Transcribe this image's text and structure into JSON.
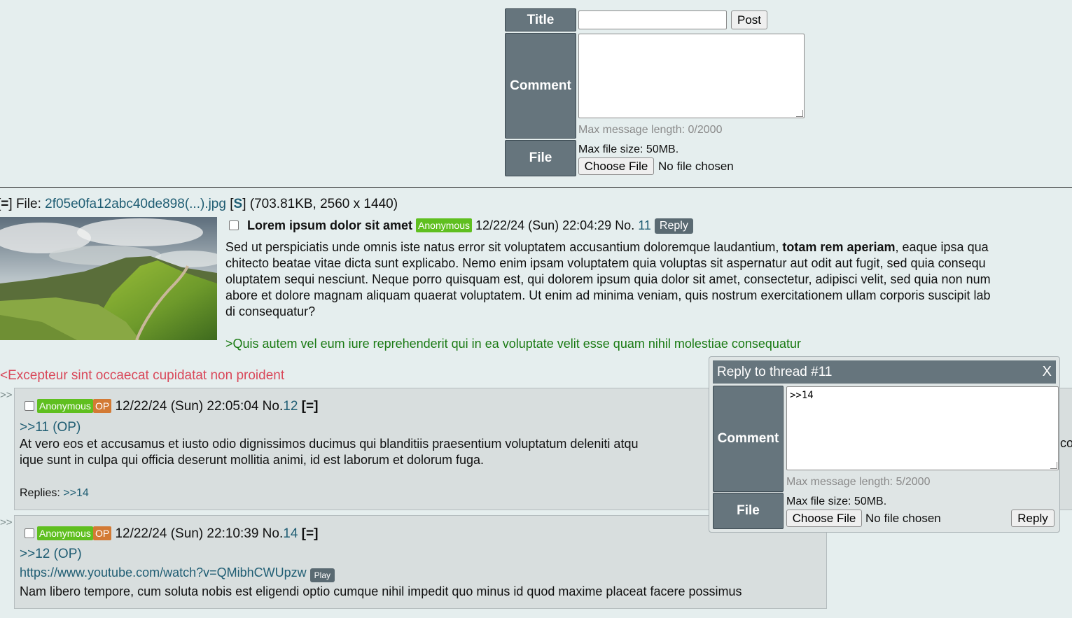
{
  "post_form": {
    "title_label": "Title",
    "title_value": "",
    "post_button": "Post",
    "comment_label": "Comment",
    "comment_value": "",
    "max_message": "Max message length: 0/2000",
    "file_label": "File",
    "max_file": "Max file size: 50MB.",
    "choose_file": "Choose File",
    "no_file": "No file chosen"
  },
  "op": {
    "file_prefix_open": "[",
    "file_prefix_eq": "=",
    "file_prefix_close": "] File:",
    "file_name": "2f05e0fa12abc40de898(...).jpg",
    "s_open": "[",
    "s_link": "S",
    "s_close": "]",
    "file_meta": "(703.81KB, 2560 x 1440)",
    "subject": "Lorem ipsum dolor sit amet",
    "name": "Anonymous",
    "datetime": "12/22/24 (Sun) 22:04:29",
    "no_label": "No.",
    "no": "11",
    "reply_button": "Reply",
    "body_lines": [
      {
        "pre": "Sed ut perspiciatis unde omnis iste natus error sit voluptatem accusantium doloremque laudantium, ",
        "bold": "totam rem aperiam",
        "post": ", eaque ipsa qua"
      },
      {
        "pre": "chitecto beatae vitae dicta sunt explicabo. Nemo enim ipsam voluptatem quia voluptas sit aspernatur aut odit aut fugit, sed quia consequ",
        "bold": "",
        "post": ""
      },
      {
        "pre": "oluptatem sequi nesciunt. Neque porro quisquam est, qui dolorem ipsum quia dolor sit amet, consectetur, adipisci velit, sed quia non num",
        "bold": "",
        "post": ""
      },
      {
        "pre": "abore et dolore magnam aliquam quaerat voluptatem. Ut enim ad minima veniam, quis nostrum exercitationem ullam corporis suscipit lab",
        "bold": "",
        "post": ""
      },
      {
        "pre": "di consequatur?",
        "bold": "",
        "post": ""
      }
    ],
    "greentext": ">Quis autem vel eum iure reprehenderit qui in ea voluptate velit esse quam nihil molestiae consequatur",
    "redtext": "<Excepteur sint occaecat cupidatat non proident"
  },
  "replies": [
    {
      "arrow": ">>",
      "name": "Anonymous",
      "op_badge": "OP",
      "datetime": "12/22/24 (Sun) 22:05:04",
      "no_label": "No.",
      "no": "12",
      "menu": "[=]",
      "quote": ">>11 (OP)",
      "body_lines": [
        "At vero eos et accusamus et iusto odio dignissimos ducimus qui blanditiis praesentium voluptatum deleniti atqu",
        "ique sunt in culpa qui officia deserunt mollitia animi, id est laborum et dolorum fuga."
      ],
      "body_tail": "co",
      "replies_label": "Replies:",
      "replies_link": ">>14"
    },
    {
      "arrow": ">>",
      "name": "Anonymous",
      "op_badge": "OP",
      "datetime": "12/22/24 (Sun) 22:10:39",
      "no_label": "No.",
      "no": "14",
      "menu": "[=]",
      "quote": ">>12 (OP)",
      "link": "https://www.youtube.com/watch?v=QMibhCWUpzw",
      "play": "Play",
      "body": "Nam libero tempore, cum soluta nobis est eligendi optio cumque nihil impedit quo minus id quod maxime placeat facere possimus"
    }
  ],
  "quick_reply": {
    "title": "Reply to thread #11",
    "close": "X",
    "comment_label": "Comment",
    "comment_value": ">>14",
    "max_message": "Max message length: 5/2000",
    "file_label": "File",
    "max_file": "Max file size: 50MB.",
    "choose_file": "Choose File",
    "no_file": "No file chosen",
    "reply_button": "Reply"
  },
  "colors": {
    "background": "#e5eeee",
    "label_bg": "#66757d",
    "link": "#1f5d73",
    "greentext": "#1a7a13",
    "redtext": "#d9485a",
    "anon_badge": "#5fbf1f",
    "op_badge": "#d37a34"
  }
}
